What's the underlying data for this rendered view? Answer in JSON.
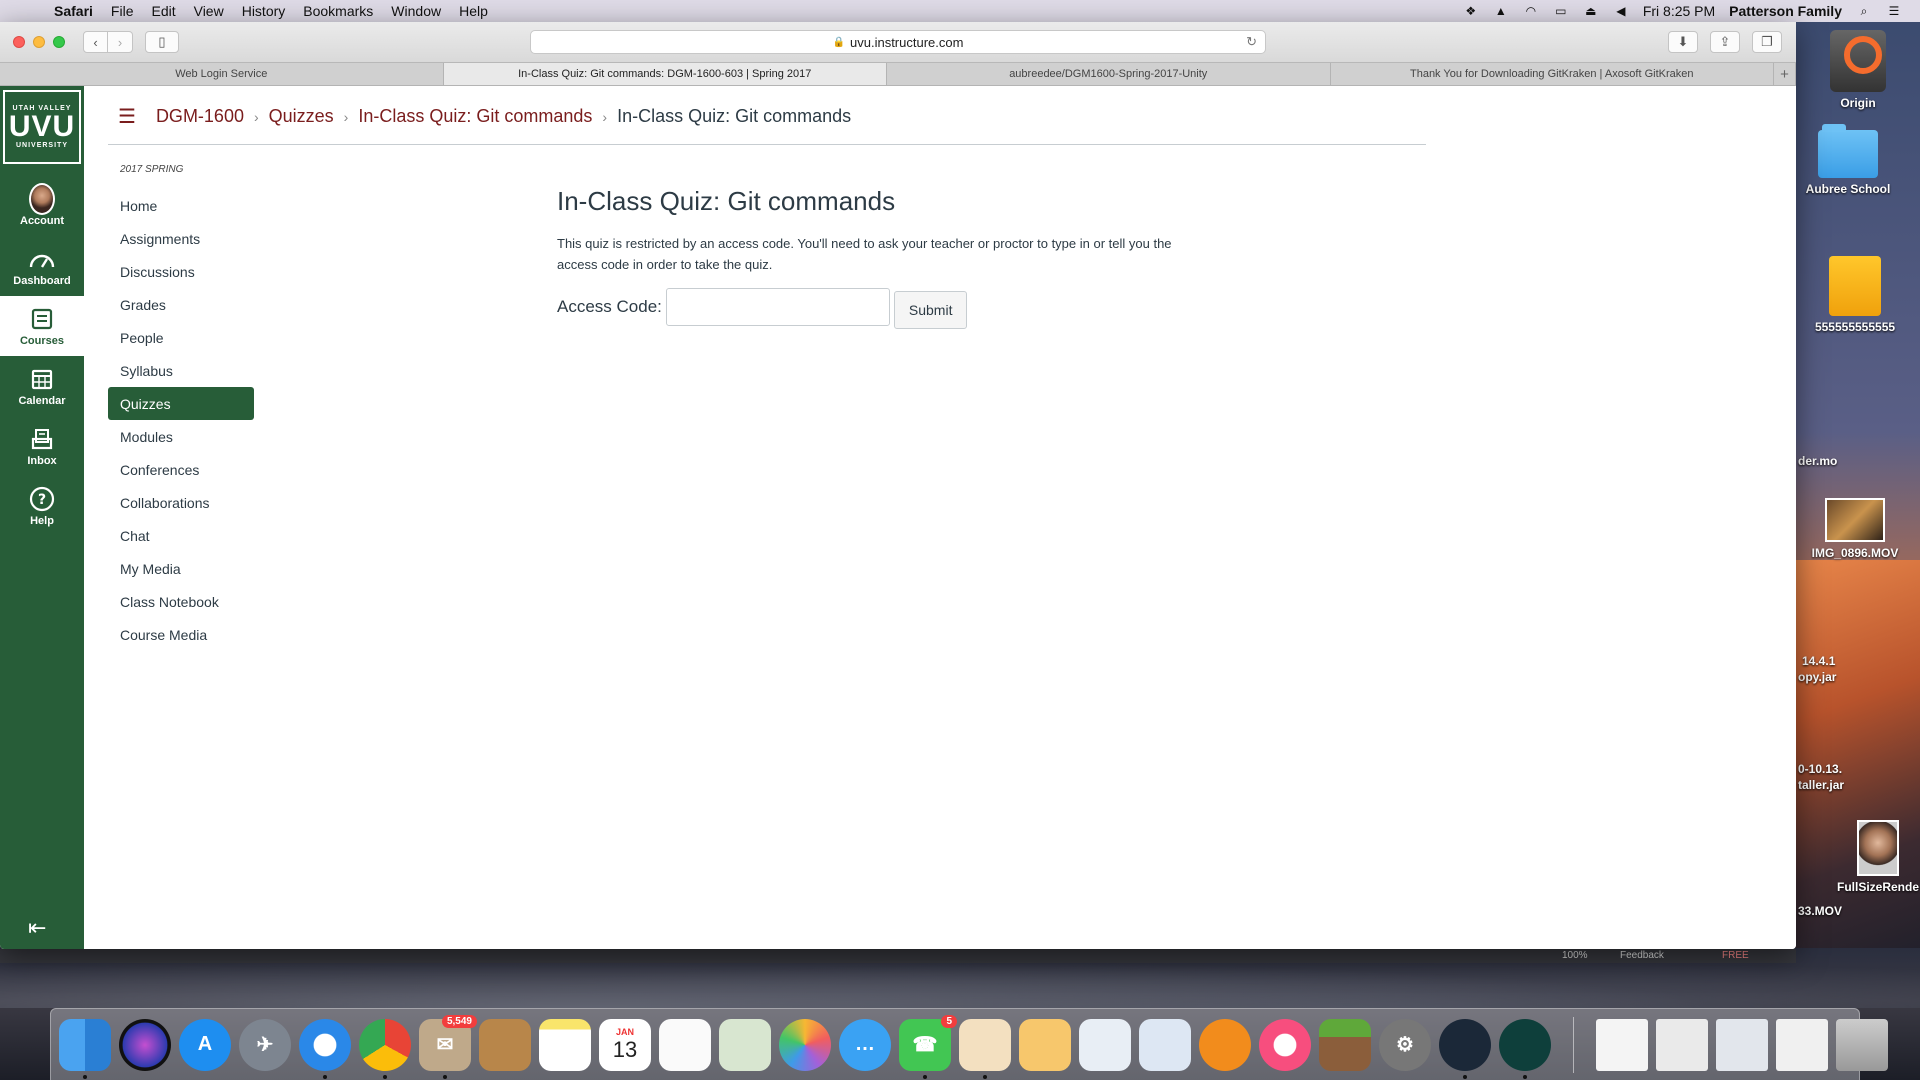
{
  "menubar": {
    "app": "Safari",
    "items": [
      "File",
      "Edit",
      "View",
      "History",
      "Bookmarks",
      "Window",
      "Help"
    ],
    "clock": "Fri 8:25 PM",
    "user": "Patterson Family"
  },
  "browser": {
    "url": "uvu.instructure.com",
    "tabs": [
      {
        "label": "Web Login Service"
      },
      {
        "label": "In-Class Quiz: Git commands: DGM-1600-603 | Spring 2017"
      },
      {
        "label": "aubreedee/DGM1600-Spring-2017-Unity"
      },
      {
        "label": "Thank You for Downloading GitKraken | Axosoft GitKraken"
      }
    ]
  },
  "global_nav": {
    "logo_top": "UTAH VALLEY",
    "logo_main": "UVU",
    "logo_bottom": "UNIVERSITY",
    "items": [
      {
        "label": "Account"
      },
      {
        "label": "Dashboard"
      },
      {
        "label": "Courses"
      },
      {
        "label": "Calendar"
      },
      {
        "label": "Inbox"
      },
      {
        "label": "Help"
      }
    ]
  },
  "breadcrumb": {
    "course": "DGM-1600",
    "section": "Quizzes",
    "quiz": "In-Class Quiz: Git commands",
    "current": "In-Class Quiz: Git commands"
  },
  "course_nav": {
    "term": "2017 SPRING",
    "items": [
      {
        "label": "Home"
      },
      {
        "label": "Assignments"
      },
      {
        "label": "Discussions"
      },
      {
        "label": "Grades"
      },
      {
        "label": "People"
      },
      {
        "label": "Syllabus"
      },
      {
        "label": "Quizzes"
      },
      {
        "label": "Modules"
      },
      {
        "label": "Conferences"
      },
      {
        "label": "Collaborations"
      },
      {
        "label": "Chat"
      },
      {
        "label": "My Media"
      },
      {
        "label": "Class Notebook"
      },
      {
        "label": "Course Media"
      }
    ]
  },
  "main": {
    "title": "In-Class Quiz: Git commands",
    "description": "This quiz is restricted by an access code. You'll need to ask your teacher or proctor to type in or tell you the access code in order to take the quiz.",
    "access_label": "Access Code:",
    "access_value": "",
    "submit_label": "Submit"
  },
  "desktop": {
    "icons": [
      {
        "label": "Origin"
      },
      {
        "label": "Aubree School"
      },
      {
        "label": "555555555555"
      },
      {
        "label": "IMG_0896.MOV"
      },
      {
        "label": "FullSizeRende"
      }
    ],
    "partial_labels": [
      "der.mo",
      "14.4.1",
      "opy.jar",
      "0-10.13.",
      "taller.jar",
      "33.MOV"
    ]
  },
  "background_app": {
    "zoom": "100%",
    "feedback": "Feedback",
    "free": "FREE"
  },
  "dock": {
    "badges": {
      "mail": "5,549",
      "facetime": "5"
    },
    "calendar_month": "JAN",
    "calendar_day": "13"
  },
  "colors": {
    "brand_green": "#275d38",
    "link": "#7a1d1d"
  }
}
